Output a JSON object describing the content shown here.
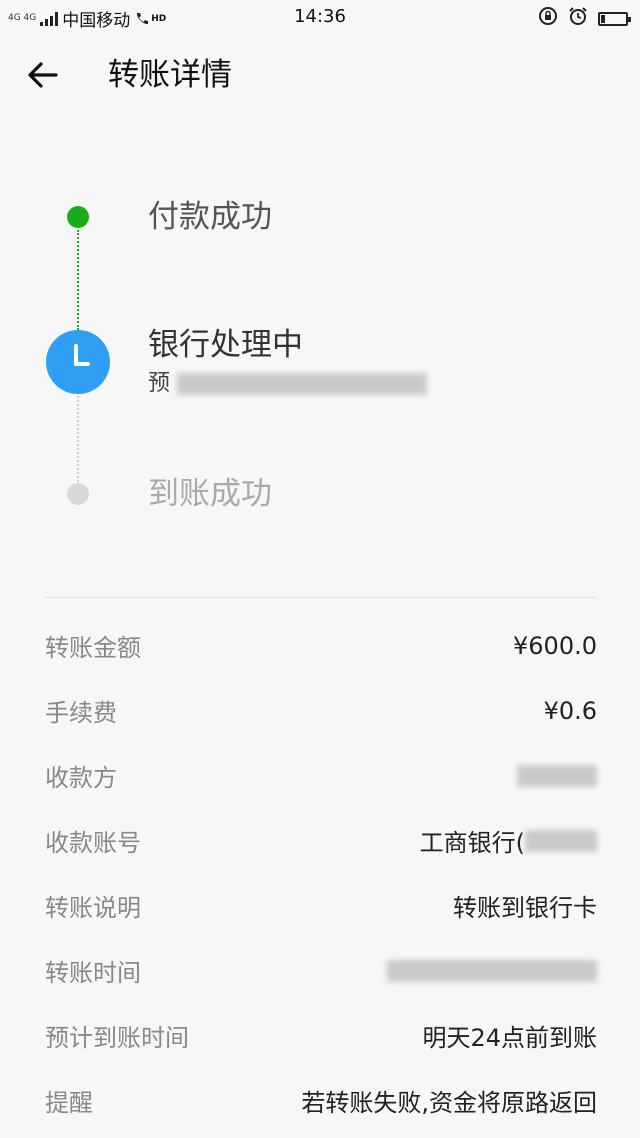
{
  "status_bar": {
    "network": "4G 4G",
    "carrier": "中国移动",
    "hd": "HD",
    "time": "14:36"
  },
  "header": {
    "title": "转账详情"
  },
  "progress": {
    "steps": [
      {
        "label": "付款成功",
        "state": "done"
      },
      {
        "label": "银行处理中",
        "state": "current",
        "subtitle": "预"
      },
      {
        "label": "到账成功",
        "state": "pending"
      }
    ]
  },
  "details": [
    {
      "label": "转账金额",
      "value": "¥600.0"
    },
    {
      "label": "手续费",
      "value": "¥0.6"
    },
    {
      "label": "收款方",
      "value": ""
    },
    {
      "label": "收款账号",
      "value": "工商银行("
    },
    {
      "label": "转账说明",
      "value": "转账到银行卡"
    },
    {
      "label": "转账时间",
      "value": ""
    },
    {
      "label": "预计到账时间",
      "value": "明天24点前到账"
    },
    {
      "label": "提醒",
      "value": "若转账失败,资金将原路返回"
    }
  ],
  "colors": {
    "success": "#1aad19",
    "processing": "#2e9ff3",
    "pending": "#d8d8d8"
  },
  "icons": [
    "back-arrow-icon",
    "clock-icon",
    "alarm-icon",
    "battery-icon",
    "phone-hd-icon",
    "signal-icon",
    "rotation-lock-icon"
  ]
}
